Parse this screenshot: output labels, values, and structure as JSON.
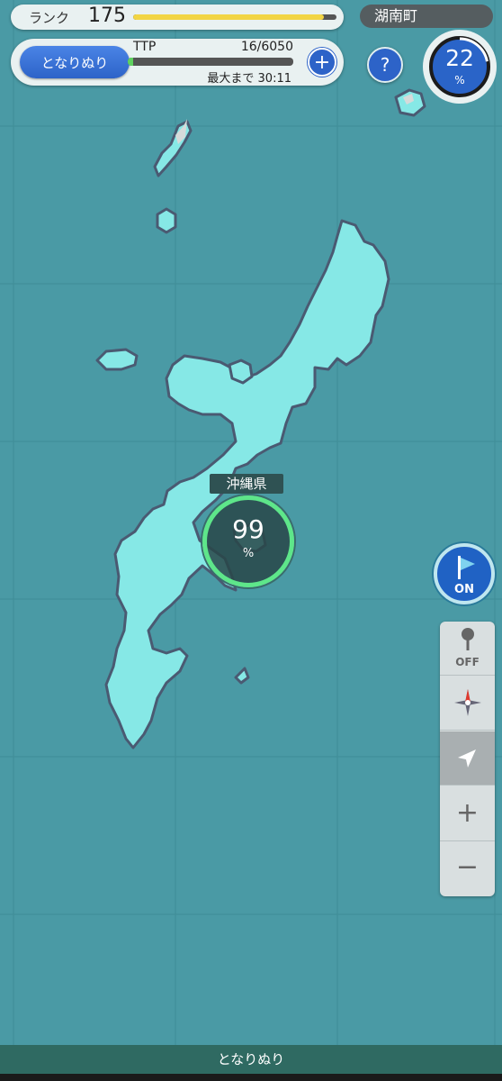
{
  "header": {
    "rank_label": "ランク",
    "rank_value": "175",
    "rank_progress": 0.94,
    "mode_button_label": "となりぬり",
    "ttp_label": "TTP",
    "ttp_count": "16/6050",
    "ttp_progress": 0.03,
    "max_label": "最大まで 30:11",
    "plus_label": "+",
    "help_label": "?"
  },
  "town": {
    "name": "湖南町",
    "percent": "22",
    "unit": "%"
  },
  "prefecture": {
    "name": "沖縄県",
    "percent": "99",
    "unit": "%"
  },
  "flag_button": {
    "label": "ON",
    "icon": "flag-icon"
  },
  "toolbar": {
    "pin_label": "OFF",
    "pin_icon": "pin-icon",
    "compass_icon": "compass-icon",
    "locate_icon": "location-arrow-icon",
    "zoom_in": "+",
    "zoom_out": "−"
  },
  "bottom_bar": {
    "label": "となりぬり"
  },
  "colors": {
    "sea": "#4a9aa5",
    "land": "#86e8e6",
    "border": "#4a5a72",
    "accent": "#2d63c8",
    "ring": "#5ee68a"
  }
}
